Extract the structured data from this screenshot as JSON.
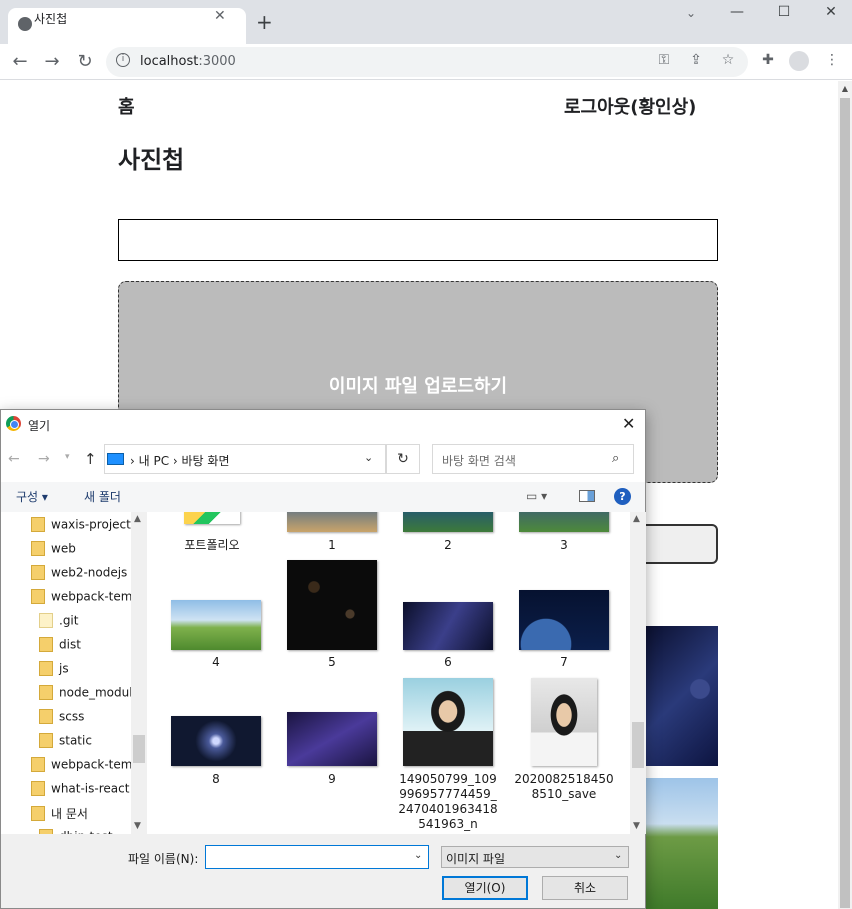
{
  "browser": {
    "tab_title": "사진첩",
    "tab_close": "✕",
    "new_tab": "+",
    "url_host": "localhost",
    "url_port": ":3000",
    "icons": [
      "globe-icon",
      "back-arrow-icon",
      "forward-arrow-icon",
      "reload-icon",
      "info-icon",
      "key-icon",
      "share-icon",
      "star-icon",
      "extensions-icon",
      "profile-icon",
      "menu-icon"
    ]
  },
  "page": {
    "nav_home": "홈",
    "nav_logout": "로그아웃(황인상)",
    "title": "사진첩",
    "upload_label": "이미지 파일 업로드하기"
  },
  "dialog": {
    "title": "열기",
    "breadcrumb": "›  내 PC  ›  바탕 화면",
    "search_placeholder": "바탕 화면 검색",
    "organize": "구성 ▾",
    "new_folder": "새 폴더",
    "tree": [
      {
        "label": "waxis-project",
        "indent": false,
        "light": false
      },
      {
        "label": "web",
        "indent": false,
        "light": false
      },
      {
        "label": "web2-nodejs",
        "indent": false,
        "light": false
      },
      {
        "label": "webpack-temp",
        "indent": false,
        "light": false
      },
      {
        "label": ".git",
        "indent": true,
        "light": true
      },
      {
        "label": "dist",
        "indent": true,
        "light": false
      },
      {
        "label": "js",
        "indent": true,
        "light": false
      },
      {
        "label": "node_module",
        "indent": true,
        "light": false
      },
      {
        "label": "scss",
        "indent": true,
        "light": false
      },
      {
        "label": "static",
        "indent": true,
        "light": false
      },
      {
        "label": "webpack-temp",
        "indent": false,
        "light": false
      },
      {
        "label": "what-is-react",
        "indent": false,
        "light": false
      },
      {
        "label": "내 문서",
        "indent": false,
        "light": false
      },
      {
        "label": "dbin-test",
        "indent": true,
        "light": false
      }
    ],
    "files": [
      {
        "name": "포트폴리오"
      },
      {
        "name": "1"
      },
      {
        "name": "2"
      },
      {
        "name": "3"
      },
      {
        "name": "4"
      },
      {
        "name": "5"
      },
      {
        "name": "6"
      },
      {
        "name": "7"
      },
      {
        "name": "8"
      },
      {
        "name": "9"
      },
      {
        "name": "149050799_109\n996957774459_\n2470401963418\n541963_n"
      },
      {
        "name": "2020082518450\n8510_save"
      }
    ],
    "filename_label": "파일 이름(N):",
    "filename_value": "",
    "filetype": "이미지 파일",
    "open_button": "열기(O)",
    "cancel_button": "취소"
  }
}
